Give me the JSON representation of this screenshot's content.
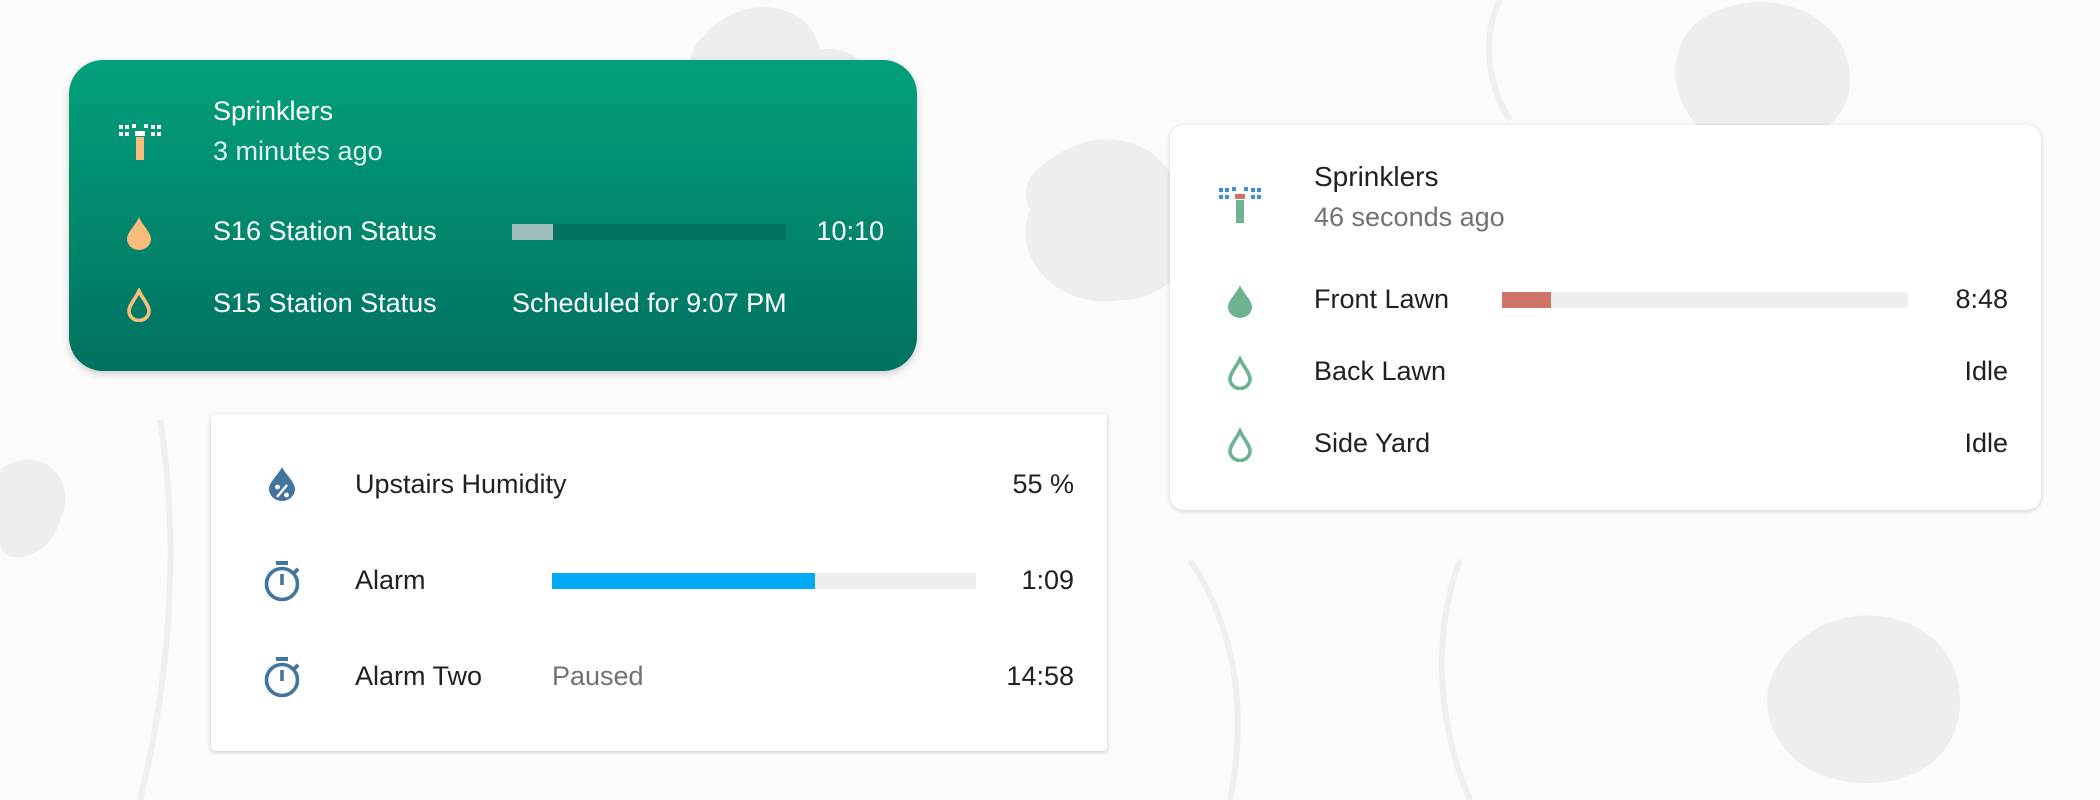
{
  "colors": {
    "background": "#fbfbfa",
    "green_card_top": "#02a07b",
    "green_card_bottom": "#017160",
    "orange_accent": "#f6bd7c",
    "timer_blue": "#03a9f4",
    "timer_icon": "#44739e",
    "lawn_red": "#d0746a",
    "lawn_green": "#6db392"
  },
  "green_sprinklers": {
    "icon": "sprinkler-icon",
    "title": "Sprinklers",
    "subtitle": "3 minutes ago",
    "rows": [
      {
        "icon": "water-drop-filled-icon",
        "name": "S16 Station Status",
        "progress": 0.15,
        "value": "10:10"
      },
      {
        "icon": "water-drop-outline-icon",
        "name": "S15 Station Status",
        "status": "Scheduled for 9:07 PM"
      }
    ]
  },
  "timers": {
    "rows": [
      {
        "icon": "water-percent-icon",
        "name": "Upstairs Humidity",
        "value": "55 %"
      },
      {
        "icon": "timer-icon",
        "name": "Alarm",
        "progress": 0.62,
        "value": "1:09"
      },
      {
        "icon": "timer-icon",
        "name": "Alarm Two",
        "status": "Paused",
        "value": "14:58"
      }
    ]
  },
  "white_sprinklers": {
    "icon": "sprinkler-icon",
    "title": "Sprinklers",
    "subtitle": "46 seconds ago",
    "rows": [
      {
        "icon": "water-drop-filled-icon",
        "name": "Front Lawn",
        "progress": 0.12,
        "value": "8:48"
      },
      {
        "icon": "water-drop-outline-icon",
        "name": "Back Lawn",
        "value": "Idle"
      },
      {
        "icon": "water-drop-outline-icon",
        "name": "Side Yard",
        "value": "Idle"
      }
    ]
  }
}
